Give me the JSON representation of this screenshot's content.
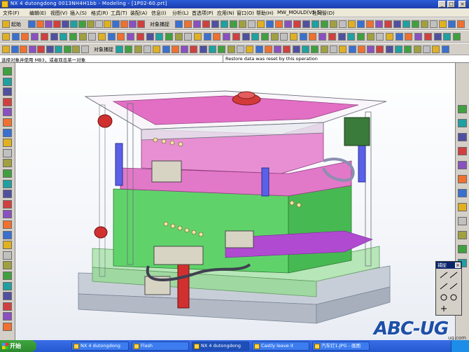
{
  "window": {
    "title": "NX 4 dutongdong  0013NH4H1bb - Modeling - [1P02-60.prt]",
    "minimize": "_",
    "maximize": "□",
    "close": "×"
  },
  "menu": {
    "items": [
      "文件(F)",
      "编辑(E)",
      "视图(V)",
      "插入(S)",
      "格式(R)",
      "工具(T)",
      "装配(A)",
      "信息(I)",
      "分析(L)",
      "首选项(P)",
      "应用(N)",
      "窗口(O)",
      "帮助(H)",
      "MW_MOULD(V5.5)",
      "杜同智(D)"
    ]
  },
  "toolbar": {
    "start_label": "起始",
    "select_label": "对象捕捉",
    "snap_label": "对象捕捉"
  },
  "status": {
    "prompt": "选择对象并使用 MB3，或者双击某一对象",
    "message": "Restore data was reset by this operation"
  },
  "palette": {
    "title": "捕捉"
  },
  "watermark": {
    "text": "ABC-UG",
    "site": "ug.com"
  },
  "taskbar": {
    "start": "开始",
    "tasks": [
      "NX 4 dutongdong",
      "Flash",
      "NX 4 dutongdong",
      "Castly leave it",
      "汽车灯1.JPG - 画图"
    ]
  },
  "colors": {
    "viewport_bg": "#ffffff",
    "mold_pink": "#e278c8",
    "mold_green": "#5fd36a",
    "mold_blue": "#7a7ef0",
    "plate_grey": "#c8ced8",
    "pale_green": "#b7e6b8"
  }
}
